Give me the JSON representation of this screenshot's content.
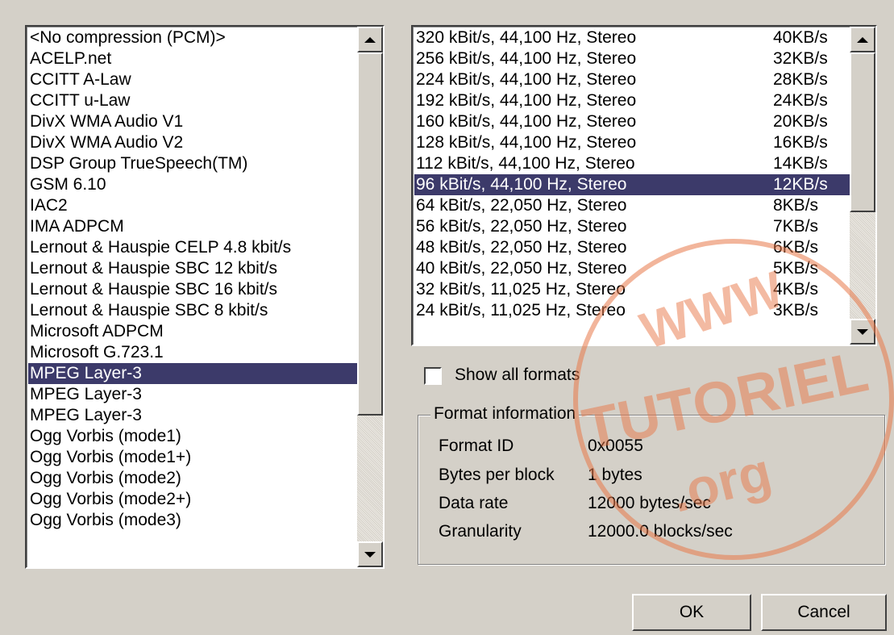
{
  "codecs": {
    "items": [
      "<No compression (PCM)>",
      "ACELP.net",
      "CCITT A-Law",
      "CCITT u-Law",
      "DivX WMA Audio V1",
      "DivX WMA Audio V2",
      "DSP Group TrueSpeech(TM)",
      "GSM 6.10",
      "IAC2",
      "IMA ADPCM",
      "Lernout & Hauspie CELP 4.8 kbit/s",
      "Lernout & Hauspie SBC 12 kbit/s",
      "Lernout & Hauspie SBC 16 kbit/s",
      "Lernout & Hauspie SBC 8 kbit/s",
      "Microsoft ADPCM",
      "Microsoft G.723.1",
      "MPEG Layer-3",
      "MPEG Layer-3",
      "MPEG Layer-3",
      "Ogg Vorbis (mode1)",
      "Ogg Vorbis (mode1+)",
      "Ogg Vorbis (mode2)",
      "Ogg Vorbis (mode2+)",
      "Ogg Vorbis (mode3)"
    ],
    "selected_index": 16
  },
  "formats": {
    "items": [
      {
        "format": "320 kBit/s, 44,100 Hz, Stereo",
        "rate": "40KB/s"
      },
      {
        "format": "256 kBit/s, 44,100 Hz, Stereo",
        "rate": "32KB/s"
      },
      {
        "format": "224 kBit/s, 44,100 Hz, Stereo",
        "rate": "28KB/s"
      },
      {
        "format": "192 kBit/s, 44,100 Hz, Stereo",
        "rate": "24KB/s"
      },
      {
        "format": "160 kBit/s, 44,100 Hz, Stereo",
        "rate": "20KB/s"
      },
      {
        "format": "128 kBit/s, 44,100 Hz, Stereo",
        "rate": "16KB/s"
      },
      {
        "format": "112 kBit/s, 44,100 Hz, Stereo",
        "rate": "14KB/s"
      },
      {
        "format": "96 kBit/s, 44,100 Hz, Stereo",
        "rate": "12KB/s"
      },
      {
        "format": "64 kBit/s, 22,050 Hz, Stereo",
        "rate": "8KB/s"
      },
      {
        "format": "56 kBit/s, 22,050 Hz, Stereo",
        "rate": "7KB/s"
      },
      {
        "format": "48 kBit/s, 22,050 Hz, Stereo",
        "rate": "6KB/s"
      },
      {
        "format": "40 kBit/s, 22,050 Hz, Stereo",
        "rate": "5KB/s"
      },
      {
        "format": "32 kBit/s, 11,025 Hz, Stereo",
        "rate": "4KB/s"
      },
      {
        "format": "24 kBit/s, 11,025 Hz, Stereo",
        "rate": "3KB/s"
      }
    ],
    "selected_index": 7
  },
  "show_all_formats": {
    "label": "Show all formats",
    "checked": false
  },
  "format_info": {
    "title": "Format information",
    "format_id_label": "Format ID",
    "format_id_value": "0x0055",
    "bytes_per_block_label": "Bytes per block",
    "bytes_per_block_value": "1 bytes",
    "data_rate_label": "Data rate",
    "data_rate_value": "12000 bytes/sec",
    "granularity_label": "Granularity",
    "granularity_value": "12000.0 blocks/sec"
  },
  "buttons": {
    "ok": "OK",
    "cancel": "Cancel"
  },
  "watermark": {
    "top": "WWW",
    "middle": "TUTORIEL",
    "bottom": ".org",
    "color": "#e87848"
  },
  "colors": {
    "selection": "#3c3a6a",
    "dialog": "#d4d0c8"
  }
}
